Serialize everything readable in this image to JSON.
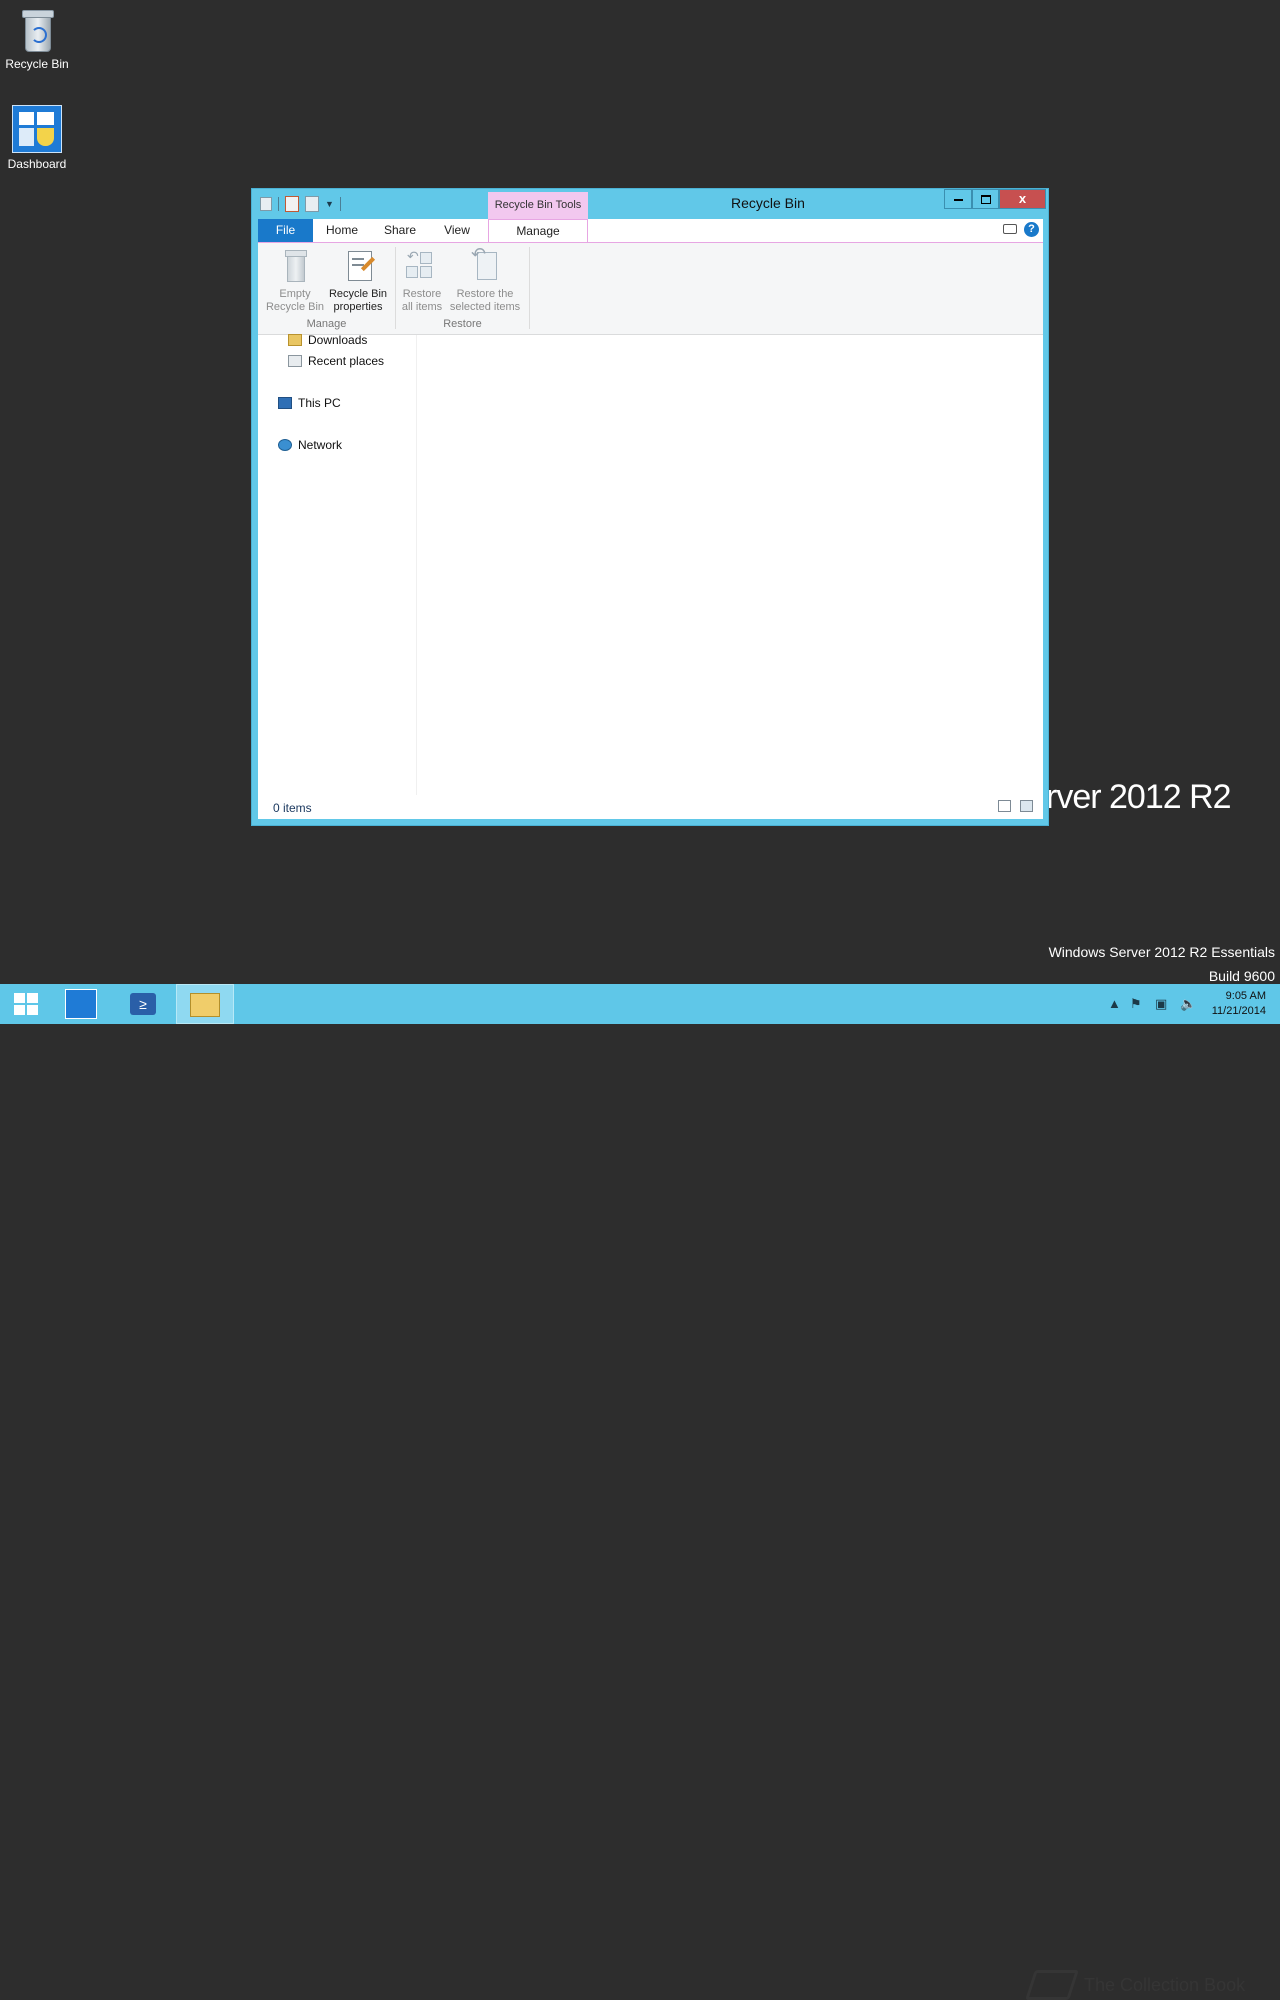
{
  "desktop": {
    "icons": [
      {
        "label": "Recycle Bin",
        "icon": "recycle-bin-icon"
      },
      {
        "label": "Dashboard",
        "icon": "dashboard-icon"
      }
    ],
    "brand_text": "rver 2012 R2",
    "edition_line1": "Windows Server 2012 R2 Essentials",
    "edition_line2": "Build 9600"
  },
  "window": {
    "title": "Recycle Bin",
    "contextual_tab_group": "Recycle Bin Tools",
    "controls": {
      "minimize": "🗕",
      "maximize": "🗖",
      "close": "x"
    },
    "tabs": {
      "file": "File",
      "home": "Home",
      "share": "Share",
      "view": "View",
      "manage": "Manage"
    },
    "help_label": "?",
    "ribbon": {
      "manage_group": "Manage",
      "restore_group": "Restore",
      "empty_line1": "Empty",
      "empty_line2": "Recycle Bin",
      "props_line1": "Recycle Bin",
      "props_line2": "properties",
      "restore_all_line1": "Restore",
      "restore_all_line2": "all items",
      "restore_sel_line1": "Restore the",
      "restore_sel_line2": "selected items"
    },
    "nav": {
      "downloads": "Downloads",
      "recent_places": "Recent places",
      "this_pc": "This PC",
      "network": "Network"
    },
    "status": "0 items"
  },
  "taskbar": {
    "time": "9:05 AM",
    "date": "11/21/2014",
    "watermark": "The Collection Book"
  },
  "colors": {
    "accent": "#1979ca",
    "window_frame": "#61c8e8",
    "contextual_tab": "#f2c8ef",
    "close_button": "#c75050",
    "desktop_bg": "#2d2d2d"
  }
}
